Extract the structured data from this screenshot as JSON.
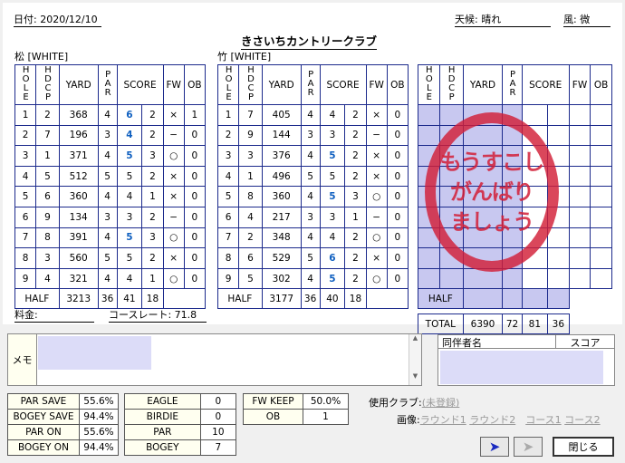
{
  "header": {
    "date_label": "日付",
    "date": "2020/12/10",
    "weather_label": "天候",
    "weather": "晴れ",
    "wind_label": "風",
    "wind": "微",
    "course_name": "きさいちカントリークラブ"
  },
  "tee_labels": {
    "left": "松 [WHITE]",
    "right": "竹 [WHITE]"
  },
  "columns": {
    "hole": "HOLE",
    "hdcp": "HDCP",
    "yard": "YARD",
    "par": "PAR",
    "score": "SCORE",
    "fw": "FW",
    "ob": "OB"
  },
  "front": {
    "rows": [
      [
        "1",
        "2",
        "368",
        "4",
        "6",
        "2",
        "×",
        "1"
      ],
      [
        "2",
        "7",
        "196",
        "3",
        "4",
        "2",
        "−",
        "0"
      ],
      [
        "3",
        "1",
        "371",
        "4",
        "5",
        "3",
        "○",
        "0"
      ],
      [
        "4",
        "5",
        "512",
        "5",
        "5",
        "2",
        "×",
        "0"
      ],
      [
        "5",
        "6",
        "360",
        "4",
        "4",
        "1",
        "×",
        "0"
      ],
      [
        "6",
        "9",
        "134",
        "3",
        "3",
        "2",
        "−",
        "0"
      ],
      [
        "7",
        "8",
        "391",
        "4",
        "5",
        "3",
        "○",
        "0"
      ],
      [
        "8",
        "3",
        "560",
        "5",
        "5",
        "2",
        "×",
        "0"
      ],
      [
        "9",
        "4",
        "321",
        "4",
        "4",
        "1",
        "○",
        "0"
      ]
    ],
    "half_label": "HALF",
    "half": [
      "3213",
      "36",
      "41",
      "18"
    ]
  },
  "back": {
    "rows": [
      [
        "1",
        "7",
        "405",
        "4",
        "4",
        "2",
        "×",
        "0"
      ],
      [
        "2",
        "9",
        "144",
        "3",
        "3",
        "2",
        "−",
        "0"
      ],
      [
        "3",
        "3",
        "376",
        "4",
        "5",
        "2",
        "×",
        "0"
      ],
      [
        "4",
        "1",
        "496",
        "5",
        "5",
        "2",
        "×",
        "0"
      ],
      [
        "5",
        "8",
        "360",
        "4",
        "5",
        "3",
        "○",
        "0"
      ],
      [
        "6",
        "4",
        "217",
        "3",
        "3",
        "1",
        "−",
        "0"
      ],
      [
        "7",
        "2",
        "348",
        "4",
        "4",
        "2",
        "○",
        "0"
      ],
      [
        "8",
        "6",
        "529",
        "5",
        "6",
        "2",
        "×",
        "0"
      ],
      [
        "9",
        "5",
        "302",
        "4",
        "5",
        "2",
        "○",
        "0"
      ]
    ],
    "half_label": "HALF",
    "half": [
      "3177",
      "36",
      "40",
      "18"
    ]
  },
  "third": {
    "half_label": "HALF",
    "total_label": "TOTAL",
    "total": [
      "6390",
      "72",
      "81",
      "36"
    ]
  },
  "stamp": [
    "もうすこし",
    "がんばり",
    "ましょう"
  ],
  "fee_label": "料金:",
  "course_rate_label": "コースレート:",
  "course_rate": "71.8",
  "memo_label": "メモ",
  "companions": {
    "col_name": "同伴者名",
    "col_score": "スコア"
  },
  "stats_a": [
    [
      "PAR SAVE",
      "55.6%"
    ],
    [
      "BOGEY SAVE",
      "94.4%"
    ],
    [
      "PAR ON",
      "55.6%"
    ],
    [
      "BOGEY ON",
      "94.4%"
    ]
  ],
  "stats_b": [
    [
      "EAGLE",
      "0"
    ],
    [
      "BIRDIE",
      "0"
    ],
    [
      "PAR",
      "10"
    ],
    [
      "BOGEY",
      "7"
    ]
  ],
  "stats_c": [
    [
      "FW KEEP",
      "50.0%"
    ],
    [
      "OB",
      "1"
    ]
  ],
  "clubs_label": "使用クラブ:",
  "clubs_value": "(未登録)",
  "image_label": "画像:",
  "image_links": [
    "ラウンド1",
    "ラウンド2",
    "コース1",
    "コース2"
  ],
  "close_label": "閉じる",
  "colors": {
    "grid": "#1c2a8c",
    "highlight": "#1060c0",
    "stamp": "#d21e37",
    "fill": "#c8c8f0"
  }
}
